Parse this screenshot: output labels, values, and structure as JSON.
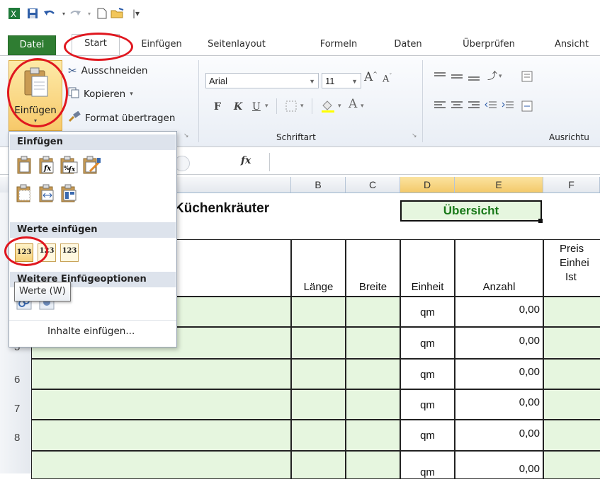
{
  "ribbon_tabs": [
    "Datei",
    "Start",
    "Einfügen",
    "Seitenlayout",
    "Formeln",
    "Daten",
    "Überprüfen",
    "Ansicht"
  ],
  "clipboard": {
    "paste_label": "Einfügen",
    "cut_label": "Ausschneiden",
    "copy_label": "Kopieren",
    "format_painter_label": "Format übertragen"
  },
  "font": {
    "name": "Arial",
    "size": "11",
    "group_label": "Schriftart",
    "bold": "F",
    "italic": "K",
    "underline": "U"
  },
  "alignment": {
    "group_label": "Ausrichtu"
  },
  "formula_bar": {
    "fx": "fx"
  },
  "columns": [
    "B",
    "C",
    "D",
    "E",
    "F"
  ],
  "rows": [
    "5",
    "6",
    "7",
    "8"
  ],
  "sheet": {
    "title": "Küchenkräuter",
    "overview": "Übersicht",
    "headers": {
      "length": "Länge",
      "width": "Breite",
      "unit": "Einheit",
      "count": "Anzahl",
      "price_line1": "Preis",
      "price_line2": "Einhei",
      "price_line3": "Ist"
    },
    "data_rows": [
      {
        "unit": "qm",
        "count": "0,00"
      },
      {
        "unit": "qm",
        "count": "0,00"
      },
      {
        "unit": "qm",
        "count": "0,00"
      },
      {
        "unit": "qm",
        "count": "0,00"
      },
      {
        "unit": "qm",
        "count": "0,00"
      },
      {
        "unit": "qm",
        "count": "0,00"
      }
    ]
  },
  "paste_menu": {
    "section_paste": "Einfügen",
    "section_values": "Werte einfügen",
    "section_more": "Weitere Einfügeoptionen",
    "special_paste": "Inhalte einfügen...",
    "value_icon_1": "123",
    "value_icon_2": "123",
    "value_icon_3": "123",
    "tooltip": "Werte (W)"
  },
  "colors": {
    "file_tab": "#2f7d32",
    "highlight_red": "#e0171f",
    "cell_green": "#e6f6df",
    "overview_text": "#1a7a1a"
  }
}
